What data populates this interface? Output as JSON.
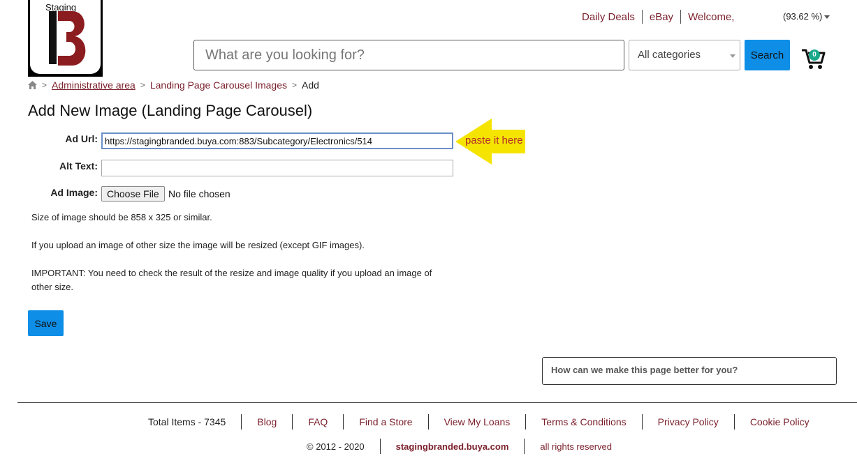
{
  "logo": {
    "label": "Staging"
  },
  "top_links": {
    "daily_deals": "Daily Deals",
    "ebay": "eBay",
    "welcome": "Welcome,",
    "zoom": "(93.62 %)"
  },
  "search": {
    "placeholder": "What are you looking for?",
    "category": "All categories",
    "button": "Search"
  },
  "cart": {
    "count": "0"
  },
  "breadcrumb": {
    "admin": "Administrative area",
    "carousel": "Landing Page Carousel Images",
    "current": "Add"
  },
  "page_title": "Add New Image (Landing Page Carousel)",
  "form": {
    "ad_url_label": "Ad Url:",
    "ad_url_value": "https://stagingbranded.buya.com:883/Subcategory/Electronics/514",
    "alt_text_label": "Alt Text:",
    "alt_text_value": "",
    "ad_image_label": "Ad Image:",
    "choose_file": "Choose File",
    "no_file": "No file chosen"
  },
  "annotation": "paste it here",
  "info": {
    "size": "Size of image should be 858 x 325 or similar.",
    "resize": "If you upload an image of other size the image will be resized (except GIF images).",
    "important": "IMPORTANT: You need to check the result of the resize and image quality if you upload an image of other size."
  },
  "save_button": "Save",
  "feedback_placeholder": "How can we make this page better for you?",
  "footer": {
    "total_items": "Total Items - 7345",
    "links": [
      "Blog",
      "FAQ",
      "Find a Store",
      "View My Loans",
      "Terms & Conditions",
      "Privacy Policy",
      "Cookie Policy"
    ],
    "copyright": "© 2012 - 2020",
    "domain": "stagingbranded.buya.com",
    "rights": "all rights reserved"
  },
  "colors": {
    "accent": "#0e8ee6",
    "link": "#7a1f2b",
    "logo_red": "#8b1c1f",
    "annotation": "#f5e400"
  },
  "icons": [
    "home-icon",
    "cart-icon",
    "chevron-down-icon",
    "arrow-left-icon"
  ]
}
